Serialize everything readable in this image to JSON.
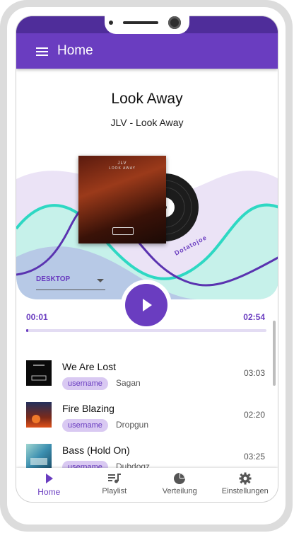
{
  "appbar": {
    "title": "Home",
    "menu_icon": "hamburger-menu-icon"
  },
  "now_playing": {
    "title": "Look Away",
    "subtitle": "JLV - Look Away",
    "cover_artist": "JLV",
    "cover_title": "LOOK AWAY",
    "vinyl_label": "Dotatojoe"
  },
  "source_select": {
    "value": "DESKTOP"
  },
  "player": {
    "current_time": "00:01",
    "duration": "02:54",
    "progress": 0.01,
    "play_icon": "play-icon"
  },
  "playlist": [
    {
      "title": "We Are Lost",
      "user_chip": "username",
      "artist": "Sagan",
      "duration": "03:03"
    },
    {
      "title": "Fire Blazing",
      "user_chip": "username",
      "artist": "Dropgun",
      "duration": "02:20"
    },
    {
      "title": "Bass (Hold On)",
      "user_chip": "username",
      "artist": "Dubdogz",
      "duration": "03:25"
    }
  ],
  "bottom_nav": [
    {
      "label": "Home",
      "icon": "play-icon",
      "active": true
    },
    {
      "label": "Playlist",
      "icon": "playlist-icon",
      "active": false
    },
    {
      "label": "Verteilung",
      "icon": "pie-chart-icon",
      "active": false
    },
    {
      "label": "Einstellungen",
      "icon": "gear-icon",
      "active": false
    }
  ],
  "colors": {
    "primary": "#6a3dc0",
    "primary_dark": "#4f2d9a",
    "wave_teal": "#2ed8c3",
    "wave_lilac": "#d7c9ee",
    "chip_bg": "#d9c9f2"
  }
}
